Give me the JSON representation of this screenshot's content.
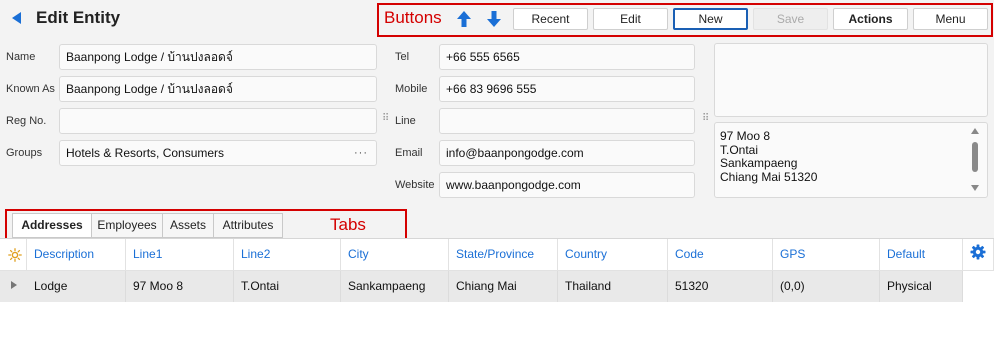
{
  "header": {
    "title": "Edit Entity"
  },
  "annotations": {
    "buttons": "Buttons",
    "tabs": "Tabs"
  },
  "toolbar": {
    "recent": "Recent",
    "edit": "Edit",
    "new": "New",
    "save": "Save",
    "actions": "Actions",
    "menu": "Menu"
  },
  "form": {
    "name_label": "Name",
    "name_value": "Baanpong Lodge / บ้านปงลอดจ์",
    "known_as_label": "Known As",
    "known_as_value": "Baanpong Lodge / บ้านปงลอดจ์",
    "reg_no_label": "Reg No.",
    "reg_no_value": "",
    "groups_label": "Groups",
    "groups_value": "Hotels & Resorts, Consumers",
    "groups_more": "···",
    "tel_label": "Tel",
    "tel_value": "+66 555 6565",
    "mobile_label": "Mobile",
    "mobile_value": "+66 83  9696 555",
    "line_label": "Line",
    "line_value": "",
    "email_label": "Email",
    "email_value": "info@baanpongodge.com",
    "website_label": "Website",
    "website_value": "www.baanpongodge.com",
    "address_text": "97 Moo 8\nT.Ontai\nSankampaeng\nChiang Mai 51320"
  },
  "tabs": [
    {
      "label": "Addresses"
    },
    {
      "label": "Employees"
    },
    {
      "label": "Assets"
    },
    {
      "label": "Attributes"
    }
  ],
  "grid": {
    "columns": [
      "Description",
      "Line1",
      "Line2",
      "City",
      "State/Province",
      "Country",
      "Code",
      "GPS",
      "Default"
    ],
    "rows": [
      [
        "Lodge",
        "97 Moo 8",
        "T.Ontai",
        "Sankampaeng",
        "Chiang Mai",
        "Thailand",
        "51320",
        "(0,0)",
        "Physical"
      ]
    ]
  },
  "colors": {
    "accent": "#1a6fd6",
    "annotation": "#d40000",
    "primary_border": "#1a5fb4"
  },
  "icons": {
    "back": "back-arrow-icon",
    "up": "arrow-up-icon",
    "down": "arrow-down-icon",
    "settings": "gear-icon",
    "sun": "sun-icon"
  }
}
